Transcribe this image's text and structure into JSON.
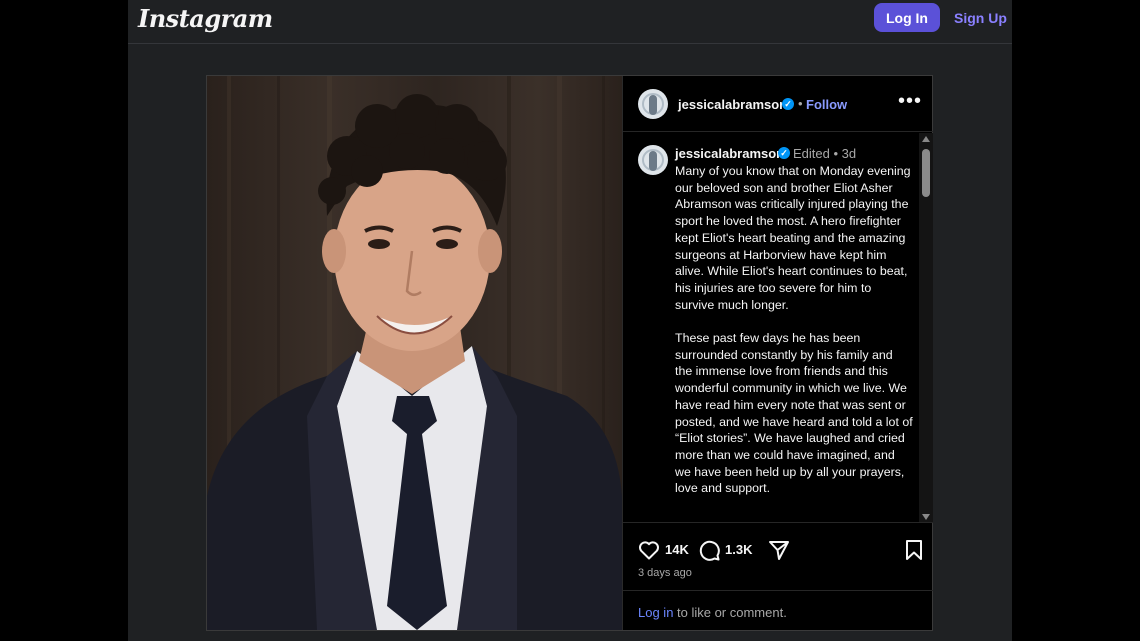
{
  "header": {
    "logo": "Instagram",
    "login_label": "Log In",
    "signup_label": "Sign Up"
  },
  "post": {
    "author": "jessicalabramson",
    "follow_label": "Follow",
    "head_dot": "•",
    "caption": {
      "author": "jessicalabramson",
      "edited": "Edited  •   3d",
      "text": "Many of you know that on Monday evening our beloved son and brother Eliot Asher Abramson was critically injured playing the sport he loved the most. A hero firefighter kept Eliot's heart beating and the amazing surgeons at Harborview have kept him alive. While Eliot's heart continues to beat, his injuries are too severe for him to survive much longer.\n\nThese past few days he has been surrounded constantly by his family and the immense love from friends and this wonderful community in which we live. We have read him every note that was sent or posted, and we have heard and told a lot of “Eliot stories”. We have laughed and cried more than we could have imagined, and we have been held up by all your prayers, love and support."
    },
    "likes": "14K",
    "comments": "1.3K",
    "time_ago": "3 days ago",
    "login_link": "Log in",
    "login_rest": "to like or comment."
  },
  "icons": {
    "verified": "verified-badge-icon",
    "more": "more-options-icon",
    "like": "heart-icon",
    "comment": "comment-icon",
    "share": "share-icon",
    "save": "bookmark-icon"
  },
  "colors": {
    "background": "#1f2123",
    "accent": "#5b51d8",
    "link": "#8a9bff",
    "verified": "#0095f6"
  }
}
